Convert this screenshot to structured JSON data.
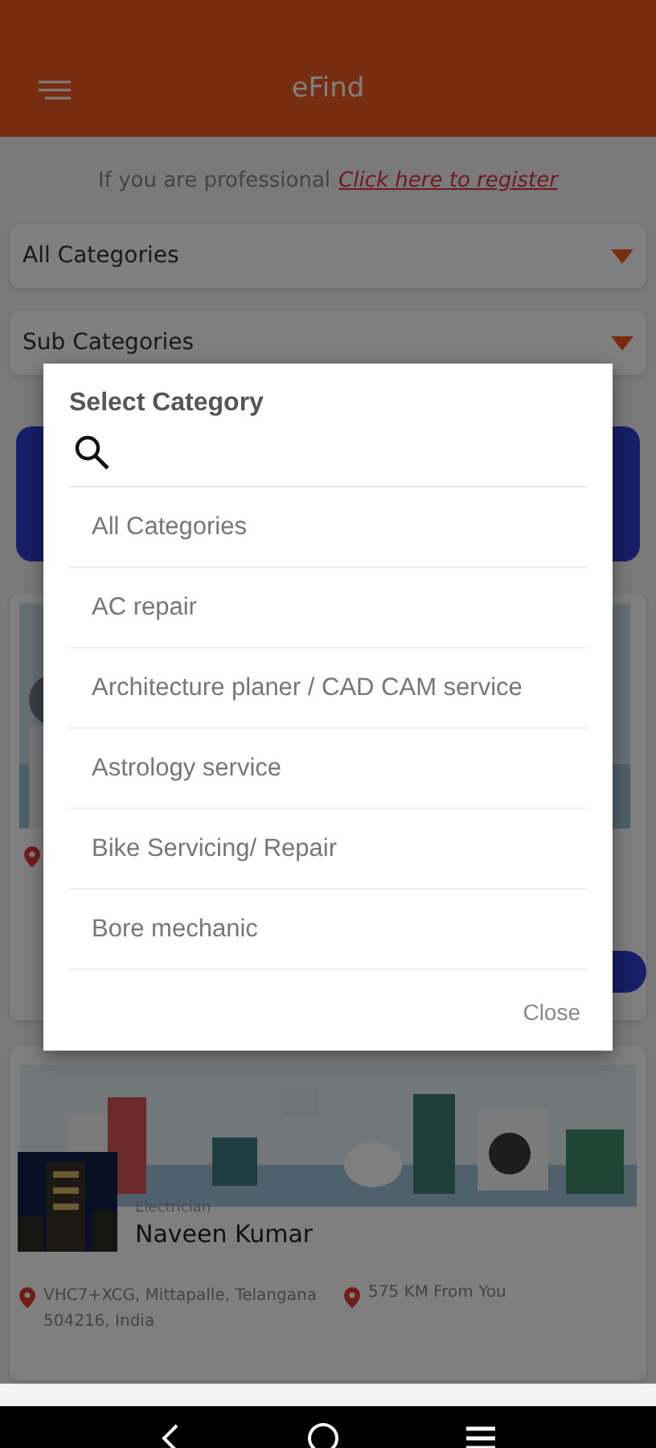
{
  "app_bar": {
    "title": "eFind"
  },
  "register_prompt": {
    "text": "If you are professional",
    "link": "Click here to register"
  },
  "filters": [
    {
      "value": "All Categories"
    },
    {
      "value": "Sub Categories"
    }
  ],
  "listing": {
    "category": "Electrician",
    "name": "Naveen Kumar",
    "address": "VHC7+XCG, Mittapalle, Telangana 504216, India",
    "distance": "575 KM From You"
  },
  "dialog": {
    "title": "Select Category",
    "options": [
      "All Categories",
      "AC repair",
      "Architecture planer / CAD CAM service",
      "Astrology service",
      "Bike Servicing/ Repair",
      "Bore mechanic"
    ],
    "close": "Close"
  }
}
